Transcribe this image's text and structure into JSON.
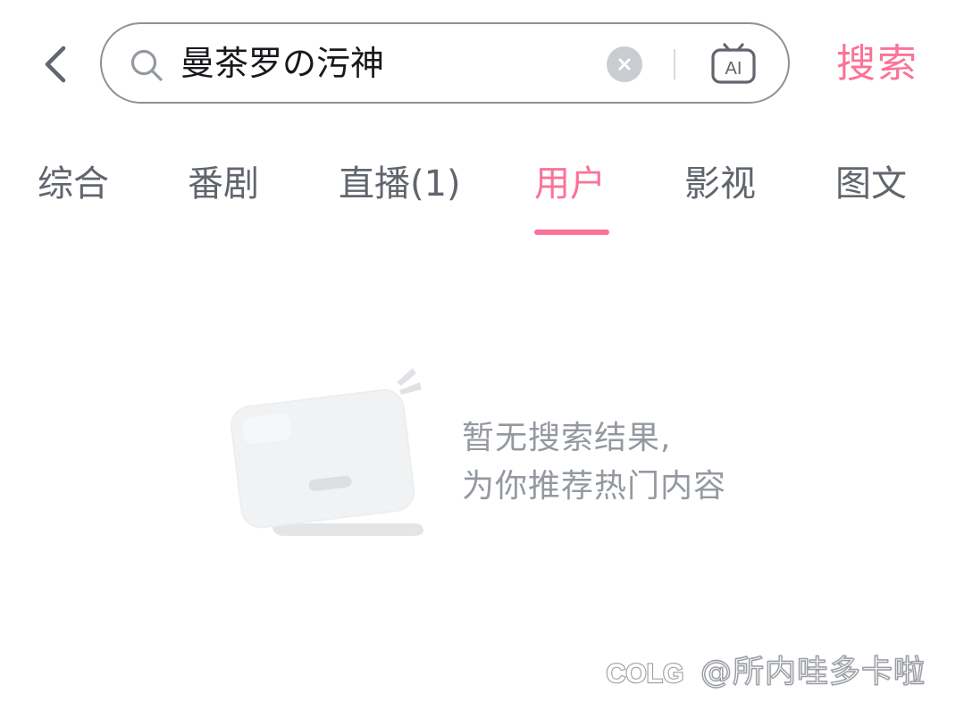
{
  "search": {
    "query": "曼茶罗の污神",
    "submit_label": "搜索",
    "icons": {
      "back": "chevron-left-icon",
      "search": "search-icon",
      "clear": "clear-icon",
      "ai": "ai-tv-icon"
    }
  },
  "tabs": [
    {
      "label": "综合",
      "active": false
    },
    {
      "label": "番剧",
      "active": false
    },
    {
      "label": "直播(1)",
      "active": false
    },
    {
      "label": "用户",
      "active": true
    },
    {
      "label": "影视",
      "active": false
    },
    {
      "label": "图文",
      "active": false
    }
  ],
  "empty_state": {
    "line1": "暂无搜索结果,",
    "line2": "为你推荐热门内容"
  },
  "watermark": {
    "logo_text": "COLG",
    "text": "@所内哇多卡啦"
  },
  "colors": {
    "accent": "#fb7299",
    "tab_text": "#61666d",
    "muted_text": "#9499a0",
    "border": "#8e9196"
  }
}
